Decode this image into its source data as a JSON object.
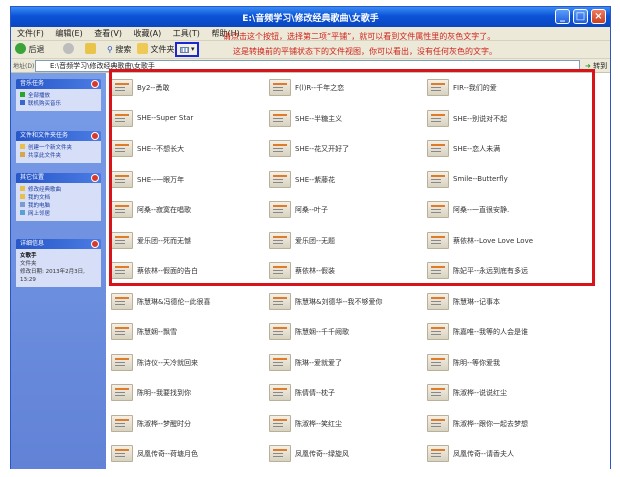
{
  "window": {
    "title": "E:\\音频学习\\修改经典歌曲\\女歌手"
  },
  "menu": [
    "文件(F)",
    "编辑(E)",
    "查看(V)",
    "收藏(A)",
    "工具(T)",
    "帮助(H)"
  ],
  "annotations": {
    "first": "请点击这个按钮，选择第二项“平铺”，就可以看到文件属性里的灰色文字了。",
    "second": "这是转换前的平铺状态下的文件视图，你可以看出，没有任何灰色的文字。"
  },
  "toolbar": {
    "back_label": "后退",
    "search_label": "搜索",
    "folders_label": "文件夹"
  },
  "address": {
    "label": "地址(D)",
    "path": "E:\\音频学习\\修改经典歌曲\\女歌手",
    "go_label": "转到"
  },
  "panels": [
    {
      "title": "音乐任务",
      "items": [
        "全部播放",
        "联机购买音乐"
      ]
    },
    {
      "title": "文件和文件夹任务",
      "items": [
        "创建一个新文件夹",
        "共享此文件夹"
      ]
    },
    {
      "title": "其它位置",
      "items": [
        "修改经典歌曲",
        "我的文档",
        "我的电脑",
        "网上邻居"
      ]
    },
    {
      "title": "详细信息",
      "items": [
        "女歌手",
        "文件夹",
        "修改日期: 2013年2月3日,",
        "13:29"
      ]
    }
  ],
  "files": [
    [
      "By2--勇敢",
      "F(l)R--千年之恋",
      "FIR--我们的爱"
    ],
    [
      "SHE--Super Star",
      "SHE--半糖主义",
      "SHE--别说对不起"
    ],
    [
      "SHE--不想长大",
      "SHE--花又开好了",
      "SHE--恋人未满"
    ],
    [
      "SHE--一眼万年",
      "SHE--紫藤花",
      "Smile--Butterfly"
    ],
    [
      "阿桑--寂寞在唱歌",
      "阿桑--叶子",
      "阿桑--一直很安静."
    ],
    [
      "爱乐团--死而无憾",
      "爱乐团--无题",
      "蔡依林--Love Love Love"
    ],
    [
      "蔡依林--假面的告白",
      "蔡依林--假装",
      "陈妃平--永远到底有多远"
    ],
    [
      "陈慧琳&冯德伦--此很喜",
      "陈慧琳&刘德华--我不够爱你",
      "陈慧琳--记事本"
    ],
    [
      "陈慧娴--飘雪",
      "陈慧娴--千千阙歌",
      "陈嘉唯--我等的人会是谁"
    ],
    [
      "陈诗仪--天冷就回来",
      "陈琳--爱就爱了",
      "陈明--等你爱我"
    ],
    [
      "陈明--我要找到你",
      "陈倩倩--枕子",
      "陈淑桦--说说红尘"
    ],
    [
      "陈淑桦--梦醒时分",
      "陈淑桦--笑红尘",
      "陈淑桦--跟你一起去梦想"
    ],
    [
      "凤凰传奇--荷塘月色",
      "凤凰传奇--绿旋风",
      "凤凰传奇--请香夫人"
    ]
  ]
}
